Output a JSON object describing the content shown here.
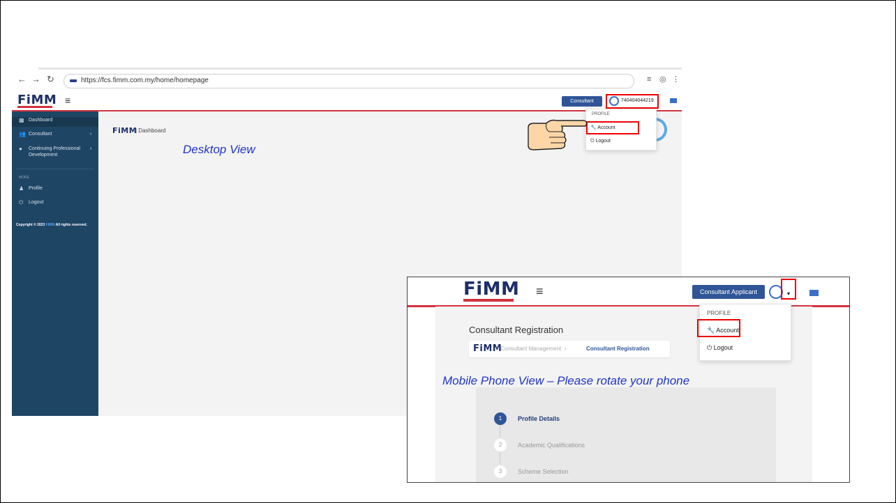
{
  "browser": {
    "url": "https://fcs.fimm.com.my/home/homepage"
  },
  "brand": {
    "logo_text": "FiMM",
    "accent_color": "#d3333f",
    "navy_color": "#1f4564",
    "button_color": "#2f5597"
  },
  "desktop": {
    "header": {
      "consultant_button": "Consultant",
      "user_id": "740404044219",
      "user_caret": "⌄"
    },
    "sidebar": {
      "items": [
        {
          "label": "Dashboard",
          "icon": "dashboard-icon"
        },
        {
          "label": "Consultant",
          "icon": "users-icon"
        },
        {
          "label": "Continuing Professional",
          "label2": "Development",
          "icon": "cpd-icon"
        }
      ],
      "section_label": "MORE",
      "more_items": [
        {
          "label": "Profile",
          "icon": "user-icon"
        },
        {
          "label": "Logout",
          "icon": "power-icon"
        }
      ],
      "copyright_prefix": "Copyright © 2023",
      "copyright_brand": "FiMM",
      "copyright_suffix": "All rights reserved."
    },
    "breadcrumb": "| Dashboard",
    "dropdown": {
      "heading": "PROFILE",
      "items": [
        {
          "label": "Account",
          "icon": "wrench-icon"
        },
        {
          "label": "Logout",
          "icon": "power-icon"
        }
      ]
    },
    "view_label": "Desktop View"
  },
  "mobile": {
    "header": {
      "consultant_button": "Consultant Applicant"
    },
    "page_title": "Consultant Registration",
    "breadcrumb": {
      "item1": "Consultant Management",
      "item2": "Consultant Registration"
    },
    "dropdown": {
      "heading": "PROFILE",
      "items": [
        {
          "label": "Account",
          "icon": "wrench-icon"
        },
        {
          "label": "Logout",
          "icon": "power-icon"
        }
      ]
    },
    "view_label": "Mobile Phone View – Please rotate your phone",
    "steps": [
      {
        "number": "1",
        "label": "Profile Details",
        "active": true
      },
      {
        "number": "2",
        "label": "Academic Qualifications",
        "active": false
      },
      {
        "number": "3",
        "label": "Scheme Selection",
        "active": false
      }
    ]
  }
}
